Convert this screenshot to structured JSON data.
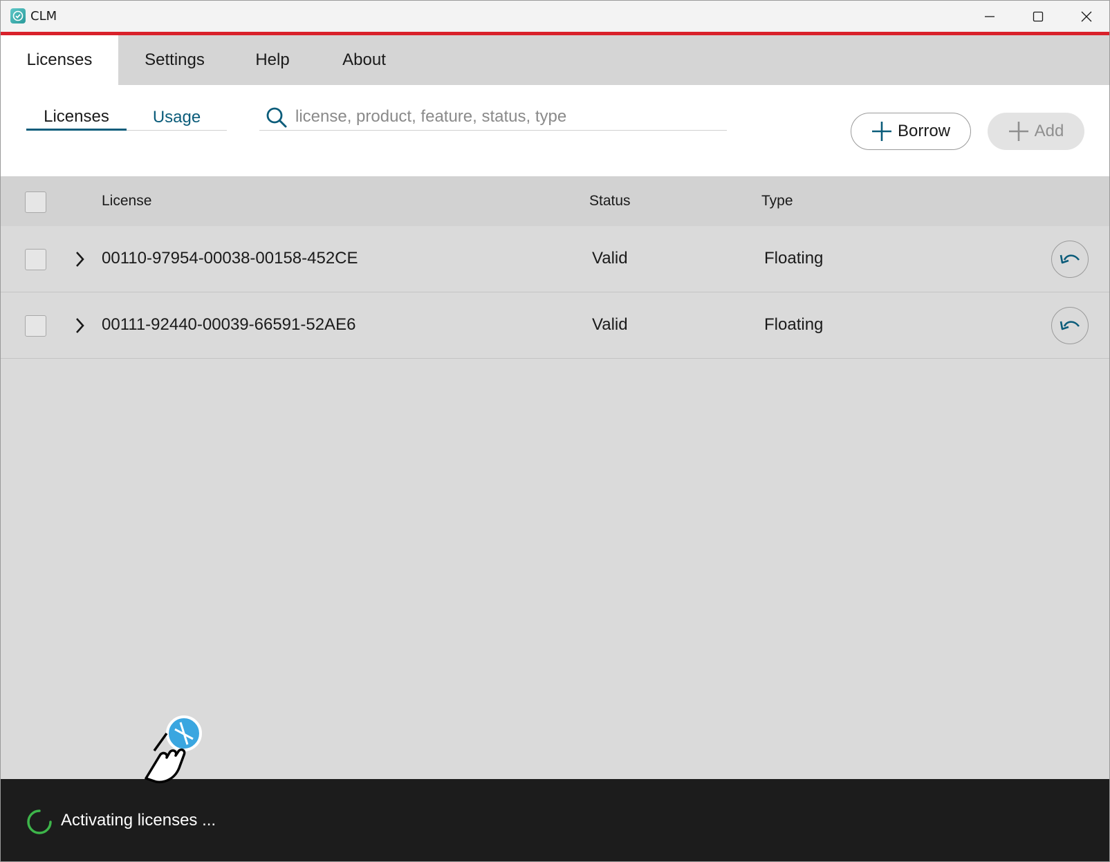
{
  "window": {
    "title": "CLM",
    "brand_color": "#d9212b",
    "accent_color": "#0b5c7a"
  },
  "main_tabs": [
    {
      "label": "Licenses",
      "active": true
    },
    {
      "label": "Settings",
      "active": false
    },
    {
      "label": "Help",
      "active": false
    },
    {
      "label": "About",
      "active": false
    }
  ],
  "sub_tabs": [
    {
      "label": "Licenses",
      "active": true
    },
    {
      "label": "Usage",
      "active": false
    }
  ],
  "search": {
    "placeholder": "license, product, feature, status, type",
    "value": ""
  },
  "toolbar": {
    "borrow_label": "Borrow",
    "add_label": "Add",
    "add_enabled": false
  },
  "table": {
    "columns": [
      "License",
      "Status",
      "Type"
    ],
    "rows": [
      {
        "license": "00110-97954-00038-00158-452CE",
        "status": "Valid",
        "type": "Floating"
      },
      {
        "license": "00111-92440-00039-66591-52AE6",
        "status": "Valid",
        "type": "Floating"
      }
    ]
  },
  "status_bar": {
    "message": "Activating licenses ..."
  }
}
